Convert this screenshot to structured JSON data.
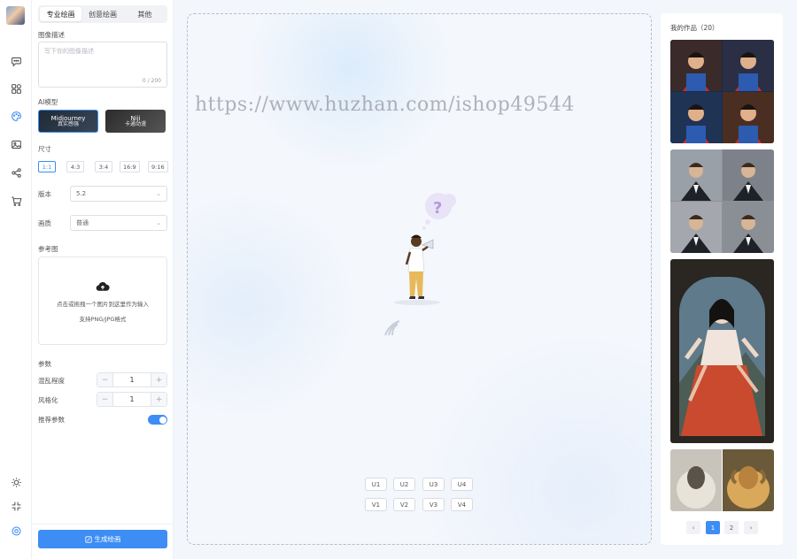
{
  "rail": {
    "icons": [
      "chat-icon",
      "apps-icon",
      "palette-icon",
      "image-icon",
      "share-icon",
      "cart-icon",
      "sun-icon",
      "collapse-icon",
      "settings-icon"
    ]
  },
  "tabs": [
    "专业绘画",
    "创意绘画",
    "其他"
  ],
  "prompt": {
    "label": "图像描述",
    "placeholder": "写下你的图像描述",
    "counter": "0 / 200"
  },
  "model": {
    "label": "AI模型",
    "options": [
      {
        "name": "Midjourney",
        "sub": "真实感强"
      },
      {
        "name": "Niji",
        "sub": "卡通动漫"
      }
    ]
  },
  "size": {
    "label": "尺寸",
    "options": [
      "1:1",
      "4:3",
      "3:4",
      "16:9",
      "9:16"
    ],
    "selected": "1:1"
  },
  "version": {
    "label": "版本",
    "value": "5.2"
  },
  "style": {
    "label": "画质",
    "value": "普通"
  },
  "reference": {
    "label": "参考图",
    "line1": "点击或拖拽一个图片到这里作为输入",
    "line2": "支持PNG/JPG格式"
  },
  "params": {
    "label": "参数",
    "chaos": {
      "label": "混乱程度",
      "value": "1"
    },
    "stylize": {
      "label": "风格化",
      "value": "1"
    },
    "recommend": {
      "label": "推荐参数",
      "enabled": true
    }
  },
  "generate_label": "生成绘画",
  "canvas": {
    "watermark": "https://www.huzhan.com/ishop49544",
    "upscale": [
      "U1",
      "U2",
      "U3",
      "U4"
    ],
    "variation": [
      "V1",
      "V2",
      "V3",
      "V4"
    ]
  },
  "gallery": {
    "title": "我的作品（20）",
    "pages": [
      "1",
      "2"
    ],
    "current_page": "1"
  }
}
